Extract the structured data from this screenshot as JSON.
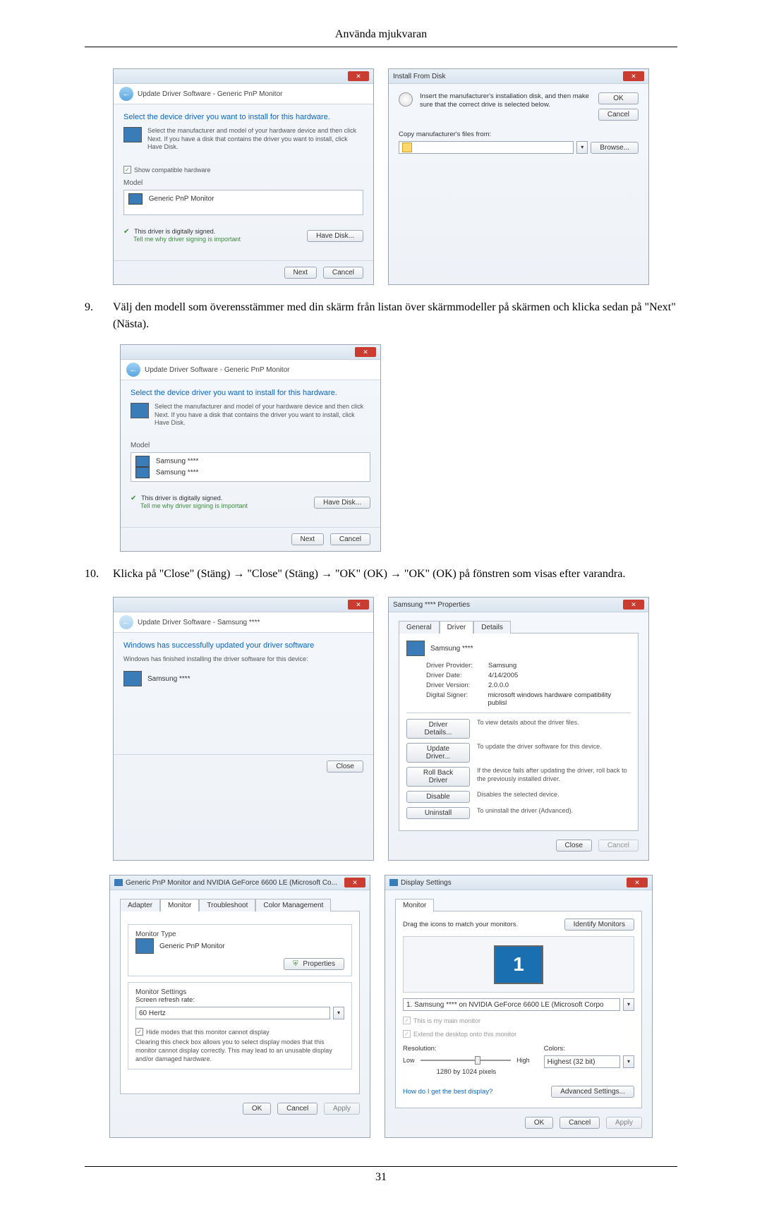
{
  "page": {
    "header": "Använda mjukvaran",
    "footer_pagenum": "31"
  },
  "step9": {
    "num": "9.",
    "text": "Välj den modell som överensstämmer med din skärm från listan över skärmmodeller på skärmen och klicka sedan på \"Next\" (Nästa)."
  },
  "step10": {
    "num": "10.",
    "text": "Klicka på \"Close\" (Stäng) → \"Close\" (Stäng) → \"OK\" (OK) → \"OK\" (OK) på fönstren som visas efter varandra."
  },
  "wizard1": {
    "nav": "Update Driver Software - Generic PnP Monitor",
    "heading": "Select the device driver you want to install for this hardware.",
    "sub": "Select the manufacturer and model of your hardware device and then click Next. If you have a disk that contains the driver you want to install, click Have Disk.",
    "show_compat": "Show compatible hardware",
    "model_label": "Model",
    "model_item": "Generic PnP Monitor",
    "signed": "This driver is digitally signed.",
    "tell_me": "Tell me why driver signing is important",
    "have_disk": "Have Disk...",
    "next": "Next",
    "cancel": "Cancel"
  },
  "install_disk": {
    "title": "Install From Disk",
    "text": "Insert the manufacturer's installation disk, and then make sure that the correct drive is selected below.",
    "ok": "OK",
    "cancel": "Cancel",
    "copy_label": "Copy manufacturer's files from:",
    "browse": "Browse..."
  },
  "wizard2": {
    "nav": "Update Driver Software - Generic PnP Monitor",
    "heading": "Select the device driver you want to install for this hardware.",
    "sub": "Select the manufacturer and model of your hardware device and then click Next. If you have a disk that contains the driver you want to install, click Have Disk.",
    "model_label": "Model",
    "m1": "Samsung ****",
    "m2": "Samsung ****",
    "signed": "This driver is digitally signed.",
    "tell_me": "Tell me why driver signing is important",
    "have_disk": "Have Disk...",
    "next": "Next",
    "cancel": "Cancel"
  },
  "wizard3": {
    "nav": "Update Driver Software - Samsung ****",
    "heading": "Windows has successfully updated your driver software",
    "sub2": "Windows has finished installing the driver software for this device:",
    "device": "Samsung ****",
    "close": "Close"
  },
  "props": {
    "title": "Samsung **** Properties",
    "tab_general": "General",
    "tab_driver": "Driver",
    "tab_details": "Details",
    "device": "Samsung ****",
    "provider_l": "Driver Provider:",
    "provider_v": "Samsung",
    "date_l": "Driver Date:",
    "date_v": "4/14/2005",
    "ver_l": "Driver Version:",
    "ver_v": "2.0.0.0",
    "signer_l": "Digital Signer:",
    "signer_v": "microsoft windows hardware compatibility publisl",
    "btn_details": "Driver Details...",
    "desc_details": "To view details about the driver files.",
    "btn_update": "Update Driver...",
    "desc_update": "To update the driver software for this device.",
    "btn_rollback": "Roll Back Driver",
    "desc_rollback": "If the device fails after updating the driver, roll back to the previously installed driver.",
    "btn_disable": "Disable",
    "desc_disable": "Disables the selected device.",
    "btn_uninstall": "Uninstall",
    "desc_uninstall": "To uninstall the driver (Advanced).",
    "close": "Close",
    "cancel": "Cancel"
  },
  "monprops": {
    "title": "Generic PnP Monitor and NVIDIA GeForce 6600 LE (Microsoft Co...",
    "tab_adapter": "Adapter",
    "tab_monitor": "Monitor",
    "tab_trouble": "Troubleshoot",
    "tab_color": "Color Management",
    "type_legend": "Monitor Type",
    "type_value": "Generic PnP Monitor",
    "properties": "Properties",
    "settings_legend": "Monitor Settings",
    "refresh_label": "Screen refresh rate:",
    "refresh_value": "60 Hertz",
    "hide_check": "Hide modes that this monitor cannot display",
    "hide_desc": "Clearing this check box allows you to select display modes that this monitor cannot display correctly. This may lead to an unusable display and/or damaged hardware.",
    "ok": "OK",
    "cancel": "Cancel",
    "apply": "Apply"
  },
  "disp": {
    "title": "Display Settings",
    "tab_monitor": "Monitor",
    "drag": "Drag the icons to match your monitors.",
    "identify": "Identify Monitors",
    "num": "1",
    "sel_monitor": "1. Samsung **** on NVIDIA GeForce 6600 LE (Microsoft Corpo",
    "main_monitor": "This is my main monitor",
    "extend": "Extend the desktop onto this monitor",
    "res_label": "Resolution:",
    "low": "Low",
    "high": "High",
    "res_value": "1280 by 1024 pixels",
    "colors_label": "Colors:",
    "colors_value": "Highest (32 bit)",
    "best_link": "How do I get the best display?",
    "advanced": "Advanced Settings...",
    "ok": "OK",
    "cancel": "Cancel",
    "apply": "Apply"
  }
}
